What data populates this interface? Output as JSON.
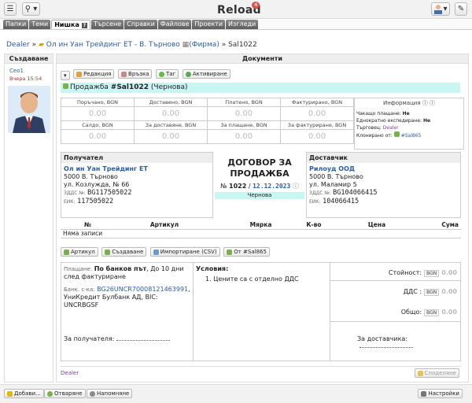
{
  "app": {
    "title": "Reload",
    "notifications": "4"
  },
  "tabs": [
    "Папки",
    "Теми",
    "Нишка",
    "Търсене",
    "Справки",
    "Файлове",
    "Проекти",
    "Изгледи"
  ],
  "tab_badge": "?",
  "breadcrumb": {
    "root": "Dealer",
    "sep1": "»",
    "company": "Ол ин Уан Трейдинг ЕТ - В. Търново",
    "firm": "(Фирма)",
    "sep2": "»",
    "doc": "Sal1022"
  },
  "left": {
    "header": "Създаване",
    "user": "Ceo1",
    "time": "Вчера 15:54"
  },
  "docs": {
    "header": "Документи",
    "toolbar": [
      "Редакция",
      "Връзка",
      "Таг",
      "Активиране"
    ],
    "title_prefix": "Продажба",
    "title_code": "#Sal1022",
    "title_state": "(Чернова)",
    "summary_labels_top": [
      "Поръчано, BGN",
      "Доставено, BGN",
      "Платено, BGN",
      "Фактурирано, BGN"
    ],
    "summary_values_top": [
      "0.00",
      "0.00",
      "0.00",
      "0.00"
    ],
    "summary_labels_bot": [
      "Салдо, BGN",
      "За доставяне, BGN",
      "За плащане, BGN",
      "За фактуриране, BGN"
    ],
    "summary_values_bot": [
      "0.00",
      "0.00",
      "0.00",
      "0.00"
    ],
    "info": {
      "title": "Информация",
      "l1": "Чакащо плащане:",
      "v1": "Не",
      "l2": "Еднократно експедиране:",
      "v2": "Не",
      "l3": "Търговец:",
      "v3": "Dealer",
      "l4": "Клонирано от:",
      "v4": "#Sal865"
    },
    "buyer": {
      "header": "Получател",
      "name": "Ол ин Уан Трейдинг ЕТ",
      "addr1": "5000 В. Търново",
      "addr2": "ул. Козлужда, № 66",
      "vat_l": "ЗДДС №:",
      "vat": "BG117505022",
      "eik_l": "ЕИК:",
      "eik": "117505022"
    },
    "contract": {
      "title": "ДОГОВОР ЗА ПРОДАЖБА",
      "num_l": "№",
      "num": "1022",
      "slash": "/",
      "date": "12.12.2023",
      "status": "Чернова"
    },
    "seller": {
      "header": "Доставчик",
      "name": "Рилоуд ООД",
      "addr1": "5000 В. Търново",
      "addr2": "ул. Маламир 5",
      "vat_l": "ЗДДС №:",
      "vat": "BG104066415",
      "eik_l": "ЕИК:",
      "eik": "104066415"
    },
    "items": {
      "cols": [
        "№",
        "Артикул",
        "Мярка",
        "К-во",
        "Цена",
        "Сума"
      ],
      "empty": "Няма записи"
    },
    "item_buttons": [
      "Артикул",
      "Създаване",
      "Импортиране (CSV)",
      "От #Sal865"
    ],
    "payment": {
      "label": "Плащане:",
      "method": "По банков път",
      "terms": ", До 10 дни след фактуриране",
      "bank_l": "Банк. с-ка:",
      "iban": "BG26UNCR70008121463991",
      "bank": ", УниКредит Булбанк АД, BIC: UNCRBGSF"
    },
    "conditions": {
      "title": "Условия:",
      "item1": "1. Цените са с отделно ДДС"
    },
    "totals": {
      "value_l": "Стойност:",
      "vat_l": "ДДС :",
      "total_l": "Общо:",
      "cur": "BGN",
      "value": "0.00",
      "vat": "0.00",
      "total": "0.00"
    },
    "sign_buyer": "За получателя:",
    "sign_seller": "За доставчика:",
    "footer_user": "Dealer",
    "share": "Споделяне"
  },
  "footer": {
    "add": "Добави...",
    "open": "Отваряне",
    "remind": "Напомняне",
    "settings": "Настройки"
  }
}
